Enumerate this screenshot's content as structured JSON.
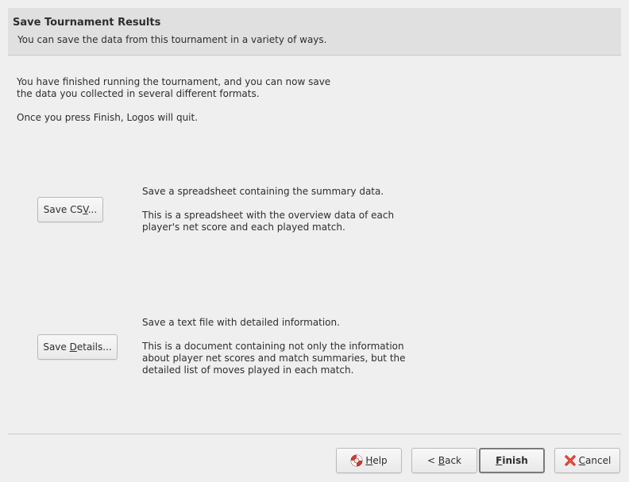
{
  "header": {
    "title": "Save Tournament Results",
    "subtitle": "You can save the data from this tournament in a variety of ways."
  },
  "intro": {
    "paragraph1": "You have finished running the tournament, and you can now save\nthe data you collected in several different formats.",
    "paragraph2": "Once you press Finish, Logos will quit."
  },
  "csv": {
    "button_pre": "Save CS",
    "button_mnemonic": "V",
    "button_post": "...",
    "summary": "Save a spreadsheet containing the summary data.",
    "detail": "This is a spreadsheet with the overview data of each player's net score and each played match."
  },
  "details": {
    "button_pre": "Save ",
    "button_mnemonic": "D",
    "button_post": "etails...",
    "summary": "Save a text file with detailed information.",
    "detail": "This is a document containing not only the information about player net scores and match summaries, but the detailed list of moves played in each match."
  },
  "footer": {
    "help_mnemonic": "H",
    "help_rest": "elp",
    "back_pre": "< ",
    "back_mnemonic": "B",
    "back_rest": "ack",
    "finish_mnemonic": "F",
    "finish_rest": "inish",
    "cancel_mnemonic": "C",
    "cancel_rest": "ancel",
    "help_icon": "lifebuoy-icon",
    "cancel_icon": "red-x-icon"
  }
}
